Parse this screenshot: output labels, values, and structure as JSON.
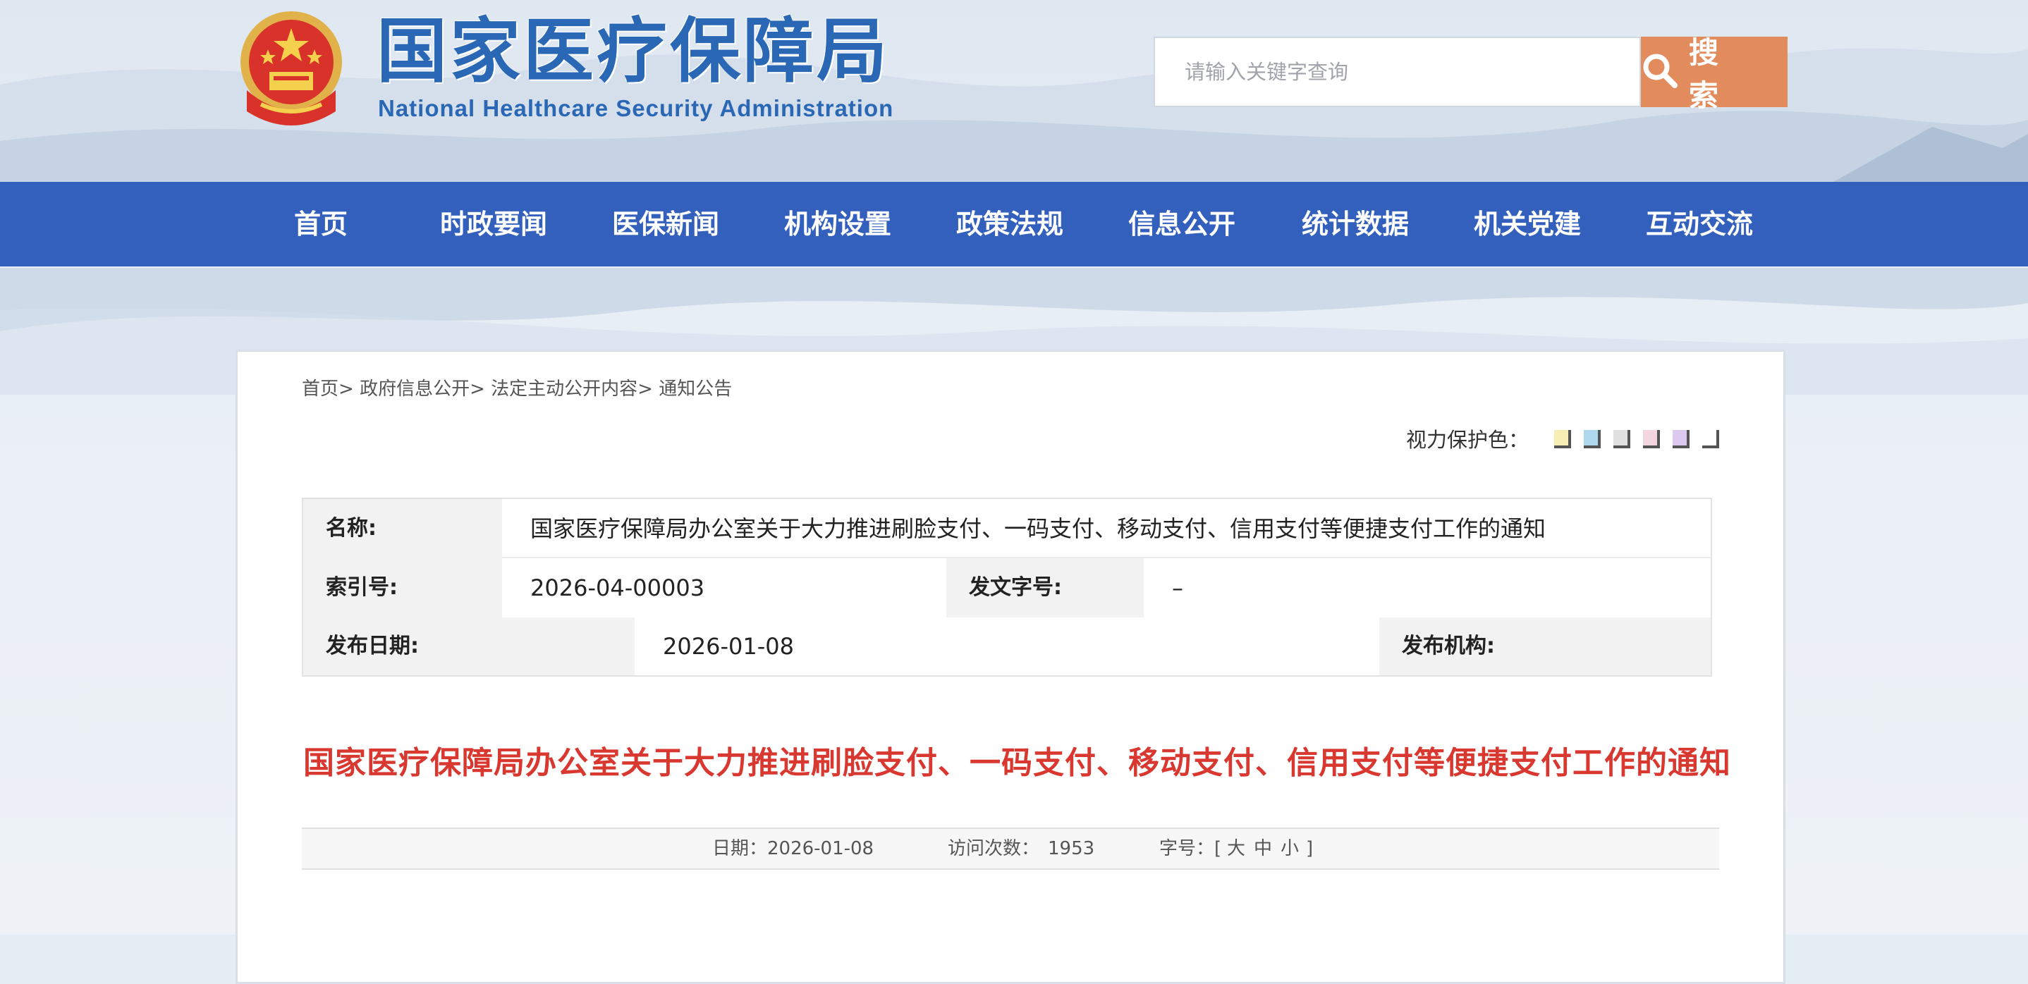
{
  "header": {
    "title_cn": "国家医疗保障局",
    "title_en": "National Healthcare Security Administration",
    "emblem": "national-emblem-icon"
  },
  "search": {
    "placeholder": "请输入关键字查询",
    "button_label": "搜 索",
    "icon": "search-icon"
  },
  "nav": {
    "items": [
      "首页",
      "时政要闻",
      "医保新闻",
      "机构设置",
      "政策法规",
      "信息公开",
      "统计数据",
      "机关党建",
      "互动交流"
    ]
  },
  "breadcrumb": [
    "首页>",
    "政府信息公开>",
    "法定主动公开内容>",
    "通知公告"
  ],
  "eye_protection": {
    "label": "视力保护色：",
    "colors": [
      "#f6eeb4",
      "#aed8ee",
      "#e0e0e0",
      "#f3d6df",
      "#dcc9ef",
      "#ffffff"
    ]
  },
  "info_table": {
    "name_label": "名称:",
    "name_value": "国家医疗保障局办公室关于大力推进刷脸支付、一码支付、移动支付、信用支付等便捷支付工作的通知",
    "index_label": "索引号:",
    "index_value": "2026-04-00003",
    "doc_no_label": "发文字号:",
    "doc_no_value": "–",
    "date_label": "发布日期:",
    "date_value": "2026-01-08",
    "org_label": "发布机构:",
    "org_value": ""
  },
  "article": {
    "title": "国家医疗保障局办公室关于大力推进刷脸支付、一码支付、移动支付、信用支付等便捷支付工作的通知",
    "date_text": "日期：2026-01-08",
    "visits_label": "访问次数：",
    "visits_value": "1953",
    "font_label": "字号：[",
    "font_large": "大",
    "font_medium": "中",
    "font_small": "小",
    "font_close": "]"
  },
  "colors": {
    "nav_bg": "#3360bd",
    "search_button": "#e28c5e",
    "title_red": "#d8382f",
    "brand_blue": "#2a68b6"
  }
}
